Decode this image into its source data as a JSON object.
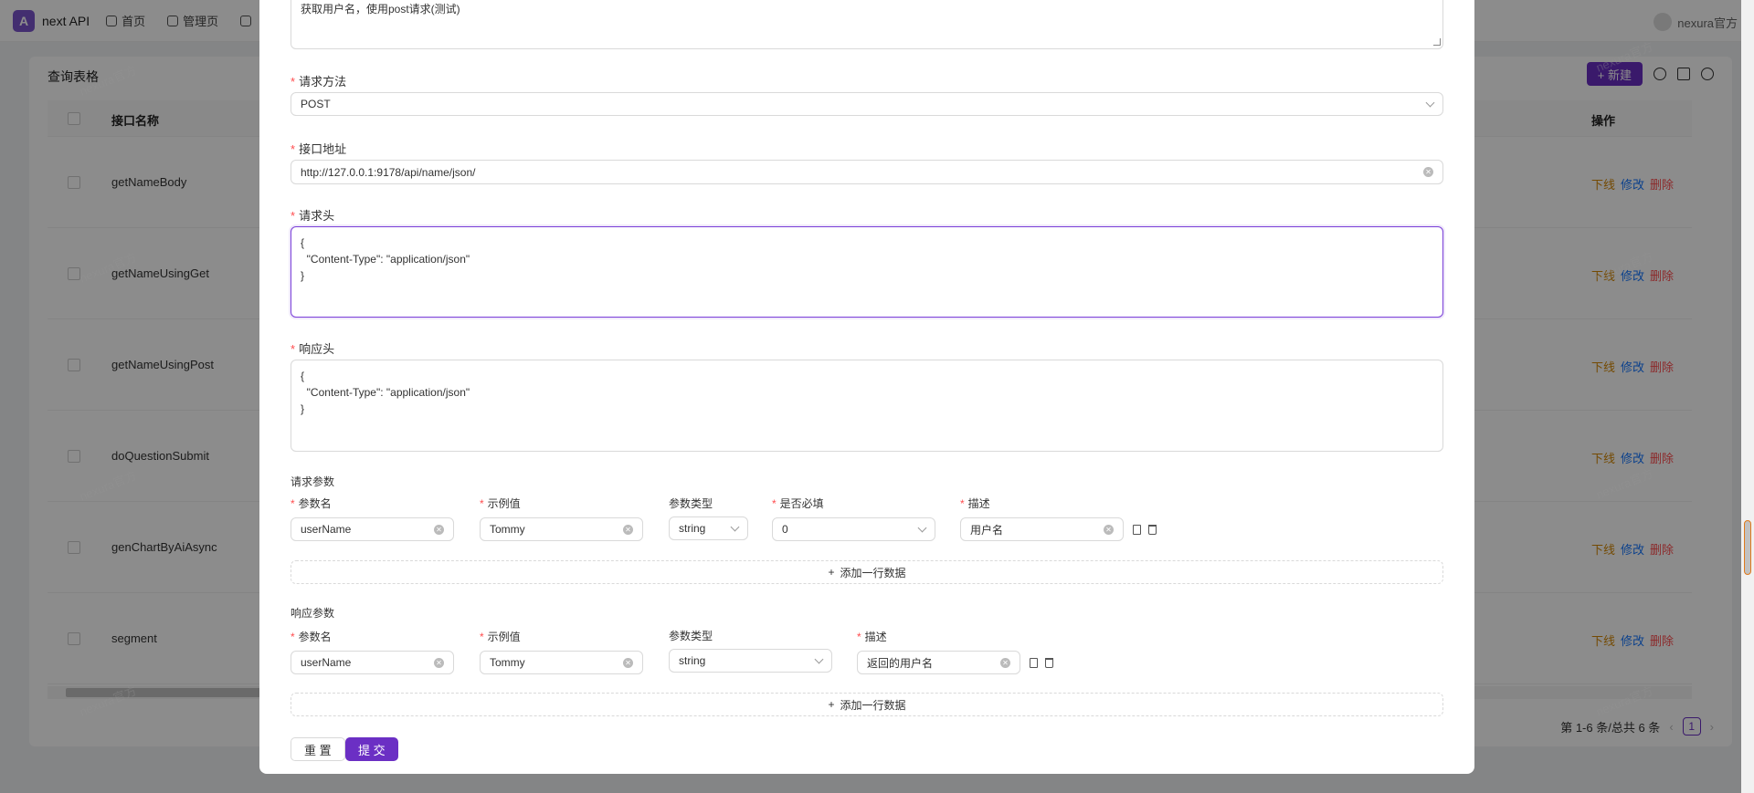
{
  "app": {
    "title": "next API",
    "nav": [
      "首页",
      "管理页"
    ],
    "user": "nexura官方"
  },
  "background": {
    "card_title": "查询表格",
    "new_button": "+ 新建",
    "columns": {
      "name": "接口名称",
      "ops": "操作"
    },
    "rows": [
      {
        "name": "getNameBody"
      },
      {
        "name": "getNameUsingGet"
      },
      {
        "name": "getNameUsingPost"
      },
      {
        "name": "doQuestionSubmit"
      },
      {
        "name": "genChartByAiAsync"
      },
      {
        "name": "segment"
      }
    ],
    "op_labels": {
      "offline": "下线",
      "edit": "修改",
      "delete": "删除"
    },
    "pager": {
      "summary": "第 1-6 条/总共 6 条",
      "current": "1"
    },
    "watermark": "nexura官方"
  },
  "modal": {
    "description_value": "获取用户名，使用post请求(测试)",
    "method": {
      "label": "请求方法",
      "value": "POST"
    },
    "url": {
      "label": "接口地址",
      "value": "http://127.0.0.1:9178/api/name/json/"
    },
    "request_header": {
      "label": "请求头",
      "value": "{\n  \"Content-Type\": \"application/json\"\n}"
    },
    "response_header": {
      "label": "响应头",
      "value": "{\n  \"Content-Type\": \"application/json\"\n}"
    },
    "request_params": {
      "label": "请求参数",
      "headers": {
        "name": "参数名",
        "example": "示例值",
        "type": "参数类型",
        "required": "是否必填",
        "desc": "描述"
      },
      "row": {
        "name": "userName",
        "example": "Tommy",
        "type": "string",
        "required": "0",
        "desc": "用户名"
      },
      "add": "添加一行数据"
    },
    "response_params": {
      "label": "响应参数",
      "headers": {
        "name": "参数名",
        "example": "示例值",
        "type": "参数类型",
        "desc": "描述"
      },
      "row": {
        "name": "userName",
        "example": "Tommy",
        "type": "string",
        "desc": "返回的用户名"
      },
      "add": "添加一行数据"
    },
    "buttons": {
      "reset": "重 置",
      "submit": "提 交"
    }
  },
  "colors": {
    "primary": "#6b2fc4",
    "offline": "#d48806",
    "edit": "#1677ff",
    "delete": "#ff4d4f"
  }
}
